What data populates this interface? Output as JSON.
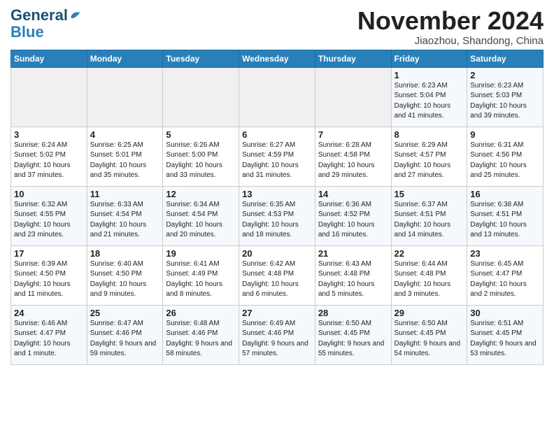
{
  "header": {
    "logo_line1": "General",
    "logo_line2": "Blue",
    "month_title": "November 2024",
    "subtitle": "Jiaozhou, Shandong, China"
  },
  "weekdays": [
    "Sunday",
    "Monday",
    "Tuesday",
    "Wednesday",
    "Thursday",
    "Friday",
    "Saturday"
  ],
  "weeks": [
    [
      {
        "day": "",
        "info": ""
      },
      {
        "day": "",
        "info": ""
      },
      {
        "day": "",
        "info": ""
      },
      {
        "day": "",
        "info": ""
      },
      {
        "day": "",
        "info": ""
      },
      {
        "day": "1",
        "info": "Sunrise: 6:23 AM\nSunset: 5:04 PM\nDaylight: 10 hours and 41 minutes."
      },
      {
        "day": "2",
        "info": "Sunrise: 6:23 AM\nSunset: 5:03 PM\nDaylight: 10 hours and 39 minutes."
      }
    ],
    [
      {
        "day": "3",
        "info": "Sunrise: 6:24 AM\nSunset: 5:02 PM\nDaylight: 10 hours and 37 minutes."
      },
      {
        "day": "4",
        "info": "Sunrise: 6:25 AM\nSunset: 5:01 PM\nDaylight: 10 hours and 35 minutes."
      },
      {
        "day": "5",
        "info": "Sunrise: 6:26 AM\nSunset: 5:00 PM\nDaylight: 10 hours and 33 minutes."
      },
      {
        "day": "6",
        "info": "Sunrise: 6:27 AM\nSunset: 4:59 PM\nDaylight: 10 hours and 31 minutes."
      },
      {
        "day": "7",
        "info": "Sunrise: 6:28 AM\nSunset: 4:58 PM\nDaylight: 10 hours and 29 minutes."
      },
      {
        "day": "8",
        "info": "Sunrise: 6:29 AM\nSunset: 4:57 PM\nDaylight: 10 hours and 27 minutes."
      },
      {
        "day": "9",
        "info": "Sunrise: 6:31 AM\nSunset: 4:56 PM\nDaylight: 10 hours and 25 minutes."
      }
    ],
    [
      {
        "day": "10",
        "info": "Sunrise: 6:32 AM\nSunset: 4:55 PM\nDaylight: 10 hours and 23 minutes."
      },
      {
        "day": "11",
        "info": "Sunrise: 6:33 AM\nSunset: 4:54 PM\nDaylight: 10 hours and 21 minutes."
      },
      {
        "day": "12",
        "info": "Sunrise: 6:34 AM\nSunset: 4:54 PM\nDaylight: 10 hours and 20 minutes."
      },
      {
        "day": "13",
        "info": "Sunrise: 6:35 AM\nSunset: 4:53 PM\nDaylight: 10 hours and 18 minutes."
      },
      {
        "day": "14",
        "info": "Sunrise: 6:36 AM\nSunset: 4:52 PM\nDaylight: 10 hours and 16 minutes."
      },
      {
        "day": "15",
        "info": "Sunrise: 6:37 AM\nSunset: 4:51 PM\nDaylight: 10 hours and 14 minutes."
      },
      {
        "day": "16",
        "info": "Sunrise: 6:38 AM\nSunset: 4:51 PM\nDaylight: 10 hours and 13 minutes."
      }
    ],
    [
      {
        "day": "17",
        "info": "Sunrise: 6:39 AM\nSunset: 4:50 PM\nDaylight: 10 hours and 11 minutes."
      },
      {
        "day": "18",
        "info": "Sunrise: 6:40 AM\nSunset: 4:50 PM\nDaylight: 10 hours and 9 minutes."
      },
      {
        "day": "19",
        "info": "Sunrise: 6:41 AM\nSunset: 4:49 PM\nDaylight: 10 hours and 8 minutes."
      },
      {
        "day": "20",
        "info": "Sunrise: 6:42 AM\nSunset: 4:48 PM\nDaylight: 10 hours and 6 minutes."
      },
      {
        "day": "21",
        "info": "Sunrise: 6:43 AM\nSunset: 4:48 PM\nDaylight: 10 hours and 5 minutes."
      },
      {
        "day": "22",
        "info": "Sunrise: 6:44 AM\nSunset: 4:48 PM\nDaylight: 10 hours and 3 minutes."
      },
      {
        "day": "23",
        "info": "Sunrise: 6:45 AM\nSunset: 4:47 PM\nDaylight: 10 hours and 2 minutes."
      }
    ],
    [
      {
        "day": "24",
        "info": "Sunrise: 6:46 AM\nSunset: 4:47 PM\nDaylight: 10 hours and 1 minute."
      },
      {
        "day": "25",
        "info": "Sunrise: 6:47 AM\nSunset: 4:46 PM\nDaylight: 9 hours and 59 minutes."
      },
      {
        "day": "26",
        "info": "Sunrise: 6:48 AM\nSunset: 4:46 PM\nDaylight: 9 hours and 58 minutes."
      },
      {
        "day": "27",
        "info": "Sunrise: 6:49 AM\nSunset: 4:46 PM\nDaylight: 9 hours and 57 minutes."
      },
      {
        "day": "28",
        "info": "Sunrise: 6:50 AM\nSunset: 4:45 PM\nDaylight: 9 hours and 55 minutes."
      },
      {
        "day": "29",
        "info": "Sunrise: 6:50 AM\nSunset: 4:45 PM\nDaylight: 9 hours and 54 minutes."
      },
      {
        "day": "30",
        "info": "Sunrise: 6:51 AM\nSunset: 4:45 PM\nDaylight: 9 hours and 53 minutes."
      }
    ]
  ]
}
